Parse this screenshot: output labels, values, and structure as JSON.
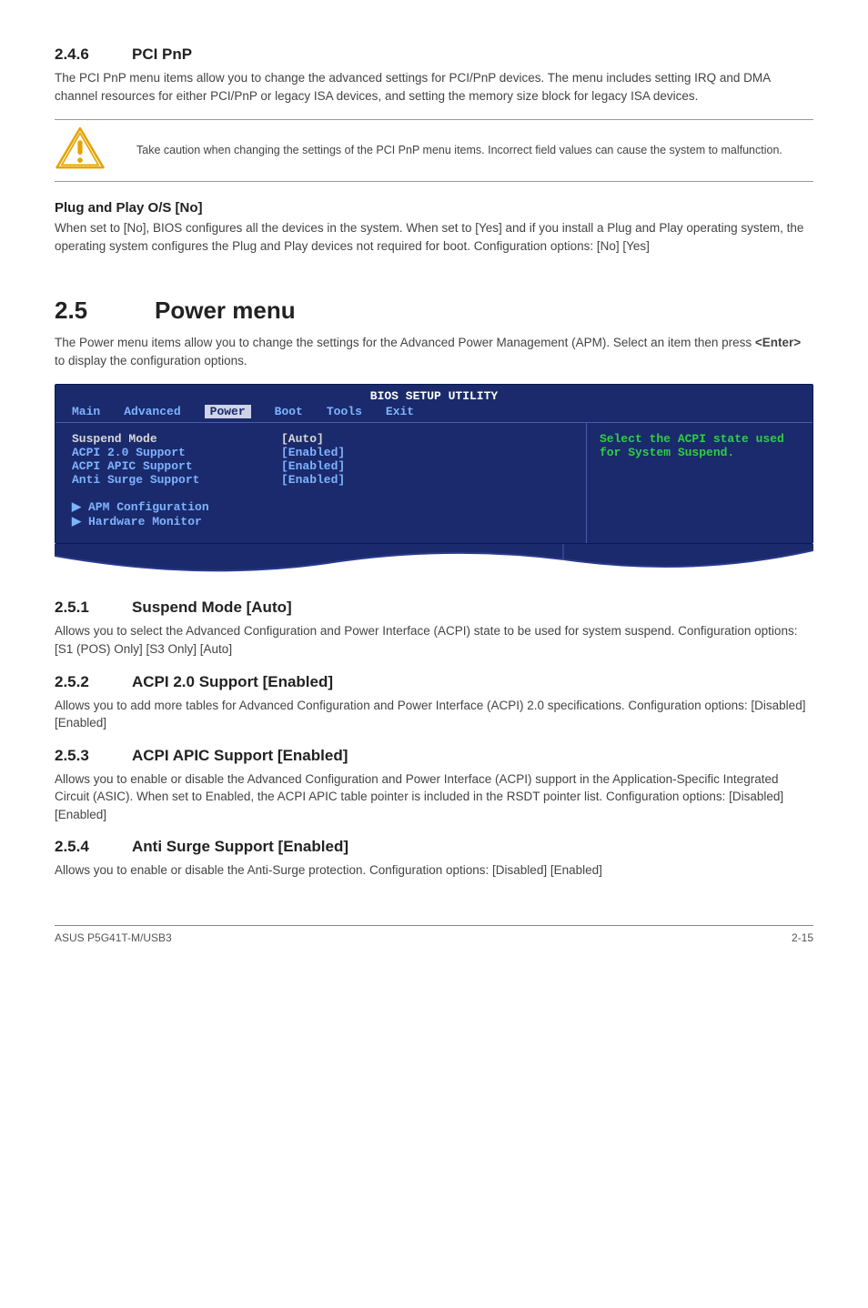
{
  "s246": {
    "heading_num": "2.4.6",
    "heading_title": "PCI PnP",
    "para": "The PCI PnP menu items allow you to change the advanced settings for PCI/PnP devices. The menu includes setting IRQ and DMA channel resources for either PCI/PnP or legacy ISA devices, and setting the memory size block for legacy ISA devices.",
    "caution": "Take caution when changing the settings of the PCI PnP menu items. Incorrect field values can cause the system to malfunction.",
    "sub_heading": "Plug and Play O/S [No]",
    "sub_para": "When set to [No], BIOS configures all the devices in the system. When set to [Yes] and if you install a Plug and Play operating system, the operating system configures the Plug and Play devices not required for boot. Configuration options: [No] [Yes]"
  },
  "s25": {
    "heading_num": "2.5",
    "heading_title": "Power menu",
    "para": "The Power menu items allow you to change the settings for the Advanced Power Management (APM). Select an item then press <Enter> to display the configuration options."
  },
  "bios": {
    "title": "BIOS SETUP UTILITY",
    "menu": {
      "main": "Main",
      "advanced": "Advanced",
      "power": "Power",
      "boot": "Boot",
      "tools": "Tools",
      "exit": "Exit"
    },
    "rows": [
      {
        "label": "Suspend Mode",
        "value": "[Auto]",
        "highlight": true
      },
      {
        "label": "ACPI 2.0 Support",
        "value": "[Enabled]",
        "highlight": false
      },
      {
        "label": "ACPI APIC Support",
        "value": "[Enabled]",
        "highlight": false
      },
      {
        "label": "Anti Surge Support",
        "value": "[Enabled]",
        "highlight": false
      }
    ],
    "sub_items": [
      "APM Configuration",
      "Hardware Monitor"
    ],
    "help": "Select the ACPI state used for System Suspend."
  },
  "s251": {
    "num": "2.5.1",
    "title": "Suspend Mode [Auto]",
    "para": "Allows you to select the Advanced Configuration and Power Interface (ACPI) state to be used for system suspend. Configuration options: [S1 (POS) Only] [S3 Only] [Auto]"
  },
  "s252": {
    "num": "2.5.2",
    "title": "ACPI 2.0 Support [Enabled]",
    "para": "Allows you to add more tables for Advanced Configuration and Power Interface (ACPI) 2.0 specifications. Configuration options: [Disabled] [Enabled]"
  },
  "s253": {
    "num": "2.5.3",
    "title": "ACPI APIC Support [Enabled]",
    "para": "Allows you to enable or disable the Advanced Configuration and Power Interface (ACPI) support in the Application-Specific Integrated Circuit (ASIC). When set to Enabled, the ACPI APIC table pointer is included in the RSDT pointer list. Configuration options: [Disabled] [Enabled]"
  },
  "s254": {
    "num": "2.5.4",
    "title": "Anti Surge Support [Enabled]",
    "para": "Allows you to enable or disable the Anti-Surge protection. Configuration options: [Disabled] [Enabled]"
  },
  "footer": {
    "left": "ASUS P5G41T-M/USB3",
    "right": "2-15"
  }
}
